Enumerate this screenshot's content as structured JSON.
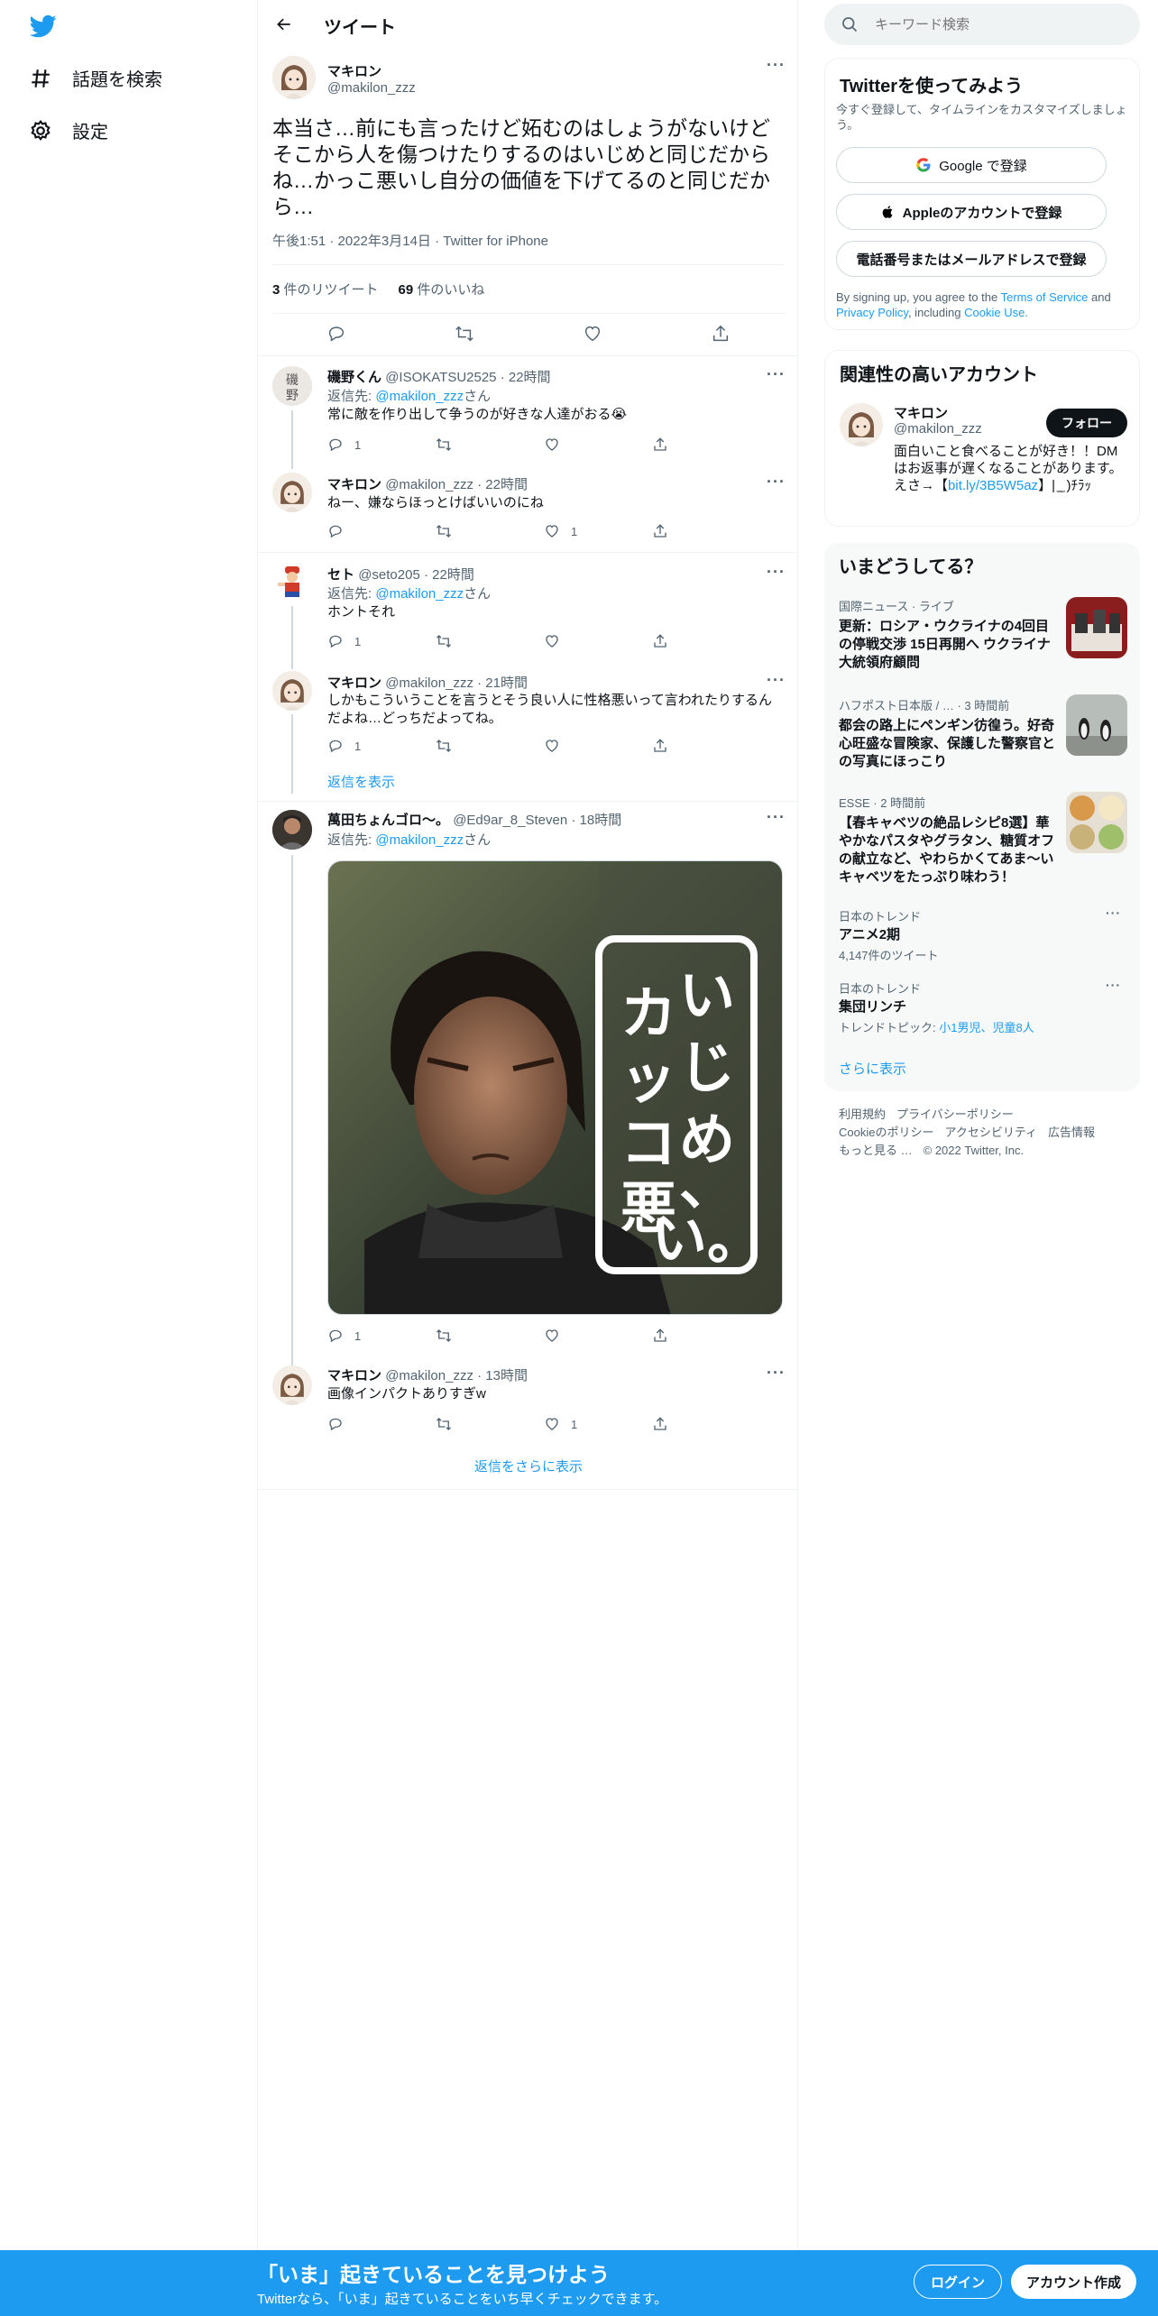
{
  "colors": {
    "accent": "#1d9bf0",
    "text": "#0f1419",
    "muted": "#536471",
    "border": "#eff3f4"
  },
  "nav": {
    "explore": "話題を検索",
    "settings": "設定"
  },
  "header": {
    "title": "ツイート"
  },
  "main_tweet": {
    "name": "マキロン",
    "handle": "@makilon_zzz",
    "text": "本当さ…前にも言ったけど妬むのはしょうがないけどそこから人を傷つけたりするのはいじめと同じだからね…かっこ悪いし自分の価値を下げてるのと同じだから…",
    "meta": "午後1:51 · 2022年3月14日 · Twitter for iPhone",
    "retweets_count": "3",
    "retweets_label": "件のリツイート",
    "likes_count": "69",
    "likes_label": "件のいいね"
  },
  "replying_label": "返信先: ",
  "replying_suffix": "さん",
  "replies": [
    {
      "name": "磯野くん",
      "handle": "@ISOKATSU2525",
      "time": "· 22時間",
      "to": "@makilon_zzz",
      "text": "常に敵を作り出して争うのが好きな人達がおる😭",
      "replies": "1",
      "likes": ""
    },
    {
      "name": "マキロン",
      "handle": "@makilon_zzz",
      "time": "· 22時間",
      "text": "ねー、嫌ならほっとけばいいのにね",
      "replies": "",
      "likes": "1"
    },
    {
      "name": "セト",
      "handle": "@seto205",
      "time": "· 22時間",
      "to": "@makilon_zzz",
      "text": "ホントそれ",
      "replies": "1",
      "likes": ""
    },
    {
      "name": "マキロン",
      "handle": "@makilon_zzz",
      "time": "· 21時間",
      "text": "しかもこういうことを言うとそう良い人に性格悪いって言われたりするんだよね…どっちだよってね。",
      "replies": "1",
      "likes": ""
    },
    {
      "name": "萬田ちょんゴロ〜。",
      "handle": "@Ed9ar_8_Steven",
      "time": "· 18時間",
      "to": "@makilon_zzz",
      "text": "",
      "replies": "1",
      "likes": "",
      "image_text": "いじめ、カッコ悪い。"
    },
    {
      "name": "マキロン",
      "handle": "@makilon_zzz",
      "time": "· 13時間",
      "text": "画像インパクトありすぎw",
      "replies": "",
      "likes": "1"
    }
  ],
  "show_replies": "返信を表示",
  "more_replies": "返信をさらに表示",
  "right": {
    "search_placeholder": "キーワード検索",
    "signup": {
      "title": "Twitterを使ってみよう",
      "subtitle": "今すぐ登録して、タイムラインをカスタマイズしましょう。",
      "google": "Google で登録",
      "apple": "Appleのアカウントで登録",
      "phone": "電話番号またはメールアドレスで登録",
      "terms_pre": "By signing up, you agree to the ",
      "terms_tos": "Terms of Service",
      "terms_and": " and ",
      "terms_privacy": "Privacy Policy",
      "terms_mid": ", including ",
      "terms_cookie": "Cookie Use."
    },
    "relevant": {
      "title": "関連性の高いアカウント",
      "name": "マキロン",
      "handle": "@makilon_zzz",
      "follow": "フォロー",
      "bio_pre": "面白いこと食べることが好き！！DMはお返事が遅くなることがあります。えさ→【",
      "bio_link": "bit.ly/3B5W5az",
      "bio_post": "】|  ̫ ̫ )ﾁﾗｯ"
    },
    "trends": {
      "title": "いまどうしてる？",
      "items": [
        {
          "cat": "国際ニュース · ライブ",
          "title": "更新：ロシア・ウクライナの4回目の停戦交渉 15日再開へ ウクライナ大統領府顧問"
        },
        {
          "cat": "ハフポスト日本版 / … · 3 時間前",
          "title": "都会の路上にペンギン彷徨う。好奇心旺盛な冒険家、保護した警察官との写真にほっこり"
        },
        {
          "cat": "ESSE · 2 時間前",
          "title": "【春キャベツの絶品レシピ8選】華やかなパスタやグラタン、糖質オフの献立など、やわらかくてあま〜いキャベツをたっぷり味わう！"
        },
        {
          "cat": "日本のトレンド",
          "title": "アニメ2期",
          "sub": "4,147件のツイート"
        },
        {
          "cat": "日本のトレンド",
          "title": "集団リンチ",
          "sub_pre": "トレンドトピック: ",
          "sub_links": "小1男児、児童8人"
        }
      ],
      "show_more": "さらに表示"
    },
    "footer": [
      "利用規約",
      "プライバシーポリシー",
      "Cookieのポリシー",
      "アクセシビリティ",
      "広告情報",
      "もっと見る …",
      "© 2022 Twitter, Inc."
    ]
  },
  "bottom_bar": {
    "title": "「いま」起きていることを見つけよう",
    "subtitle": "Twitterなら、「いま」起きていることをいち早くチェックできます。",
    "login": "ログイン",
    "signup": "アカウント作成"
  }
}
